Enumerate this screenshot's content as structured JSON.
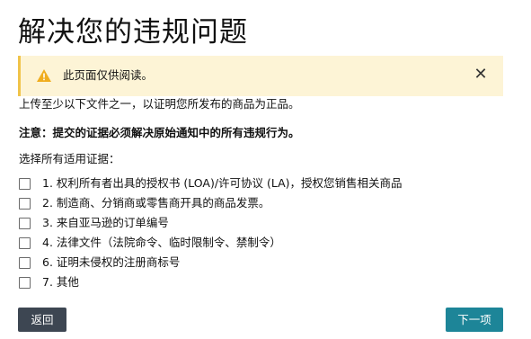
{
  "page": {
    "title": "解决您的违规问题"
  },
  "alert": {
    "icon": "warning-icon",
    "message": "此页面仅供阅读。",
    "close_icon": "close-icon",
    "background_color": "#fdf4d6",
    "accent_color": "#f0c349"
  },
  "instruction": "上传至少以下文件之一，以证明您所发布的商品为正品。",
  "notice": "注意：提交的证据必须解决原始通知中的所有违规行为。",
  "evidence": {
    "label": "选择所有适用证据：",
    "options": [
      {
        "label": "1. 权利所有者出具的授权书 (LOA)/许可协议 (LA)，授权您销售相关商品",
        "checked": false
      },
      {
        "label": "2. 制造商、分销商或零售商开具的商品发票。",
        "checked": false
      },
      {
        "label": "3. 来自亚马逊的订单编号",
        "checked": false
      },
      {
        "label": "4. 法律文件（法院命令、临时限制令、禁制令）",
        "checked": false
      },
      {
        "label": "6. 证明未侵权的注册商标号",
        "checked": false
      },
      {
        "label": "7. 其他",
        "checked": false
      }
    ]
  },
  "buttons": {
    "back_label": "返回",
    "next_label": "下一项",
    "back_color": "#3d4652",
    "next_color": "#1d8598"
  }
}
